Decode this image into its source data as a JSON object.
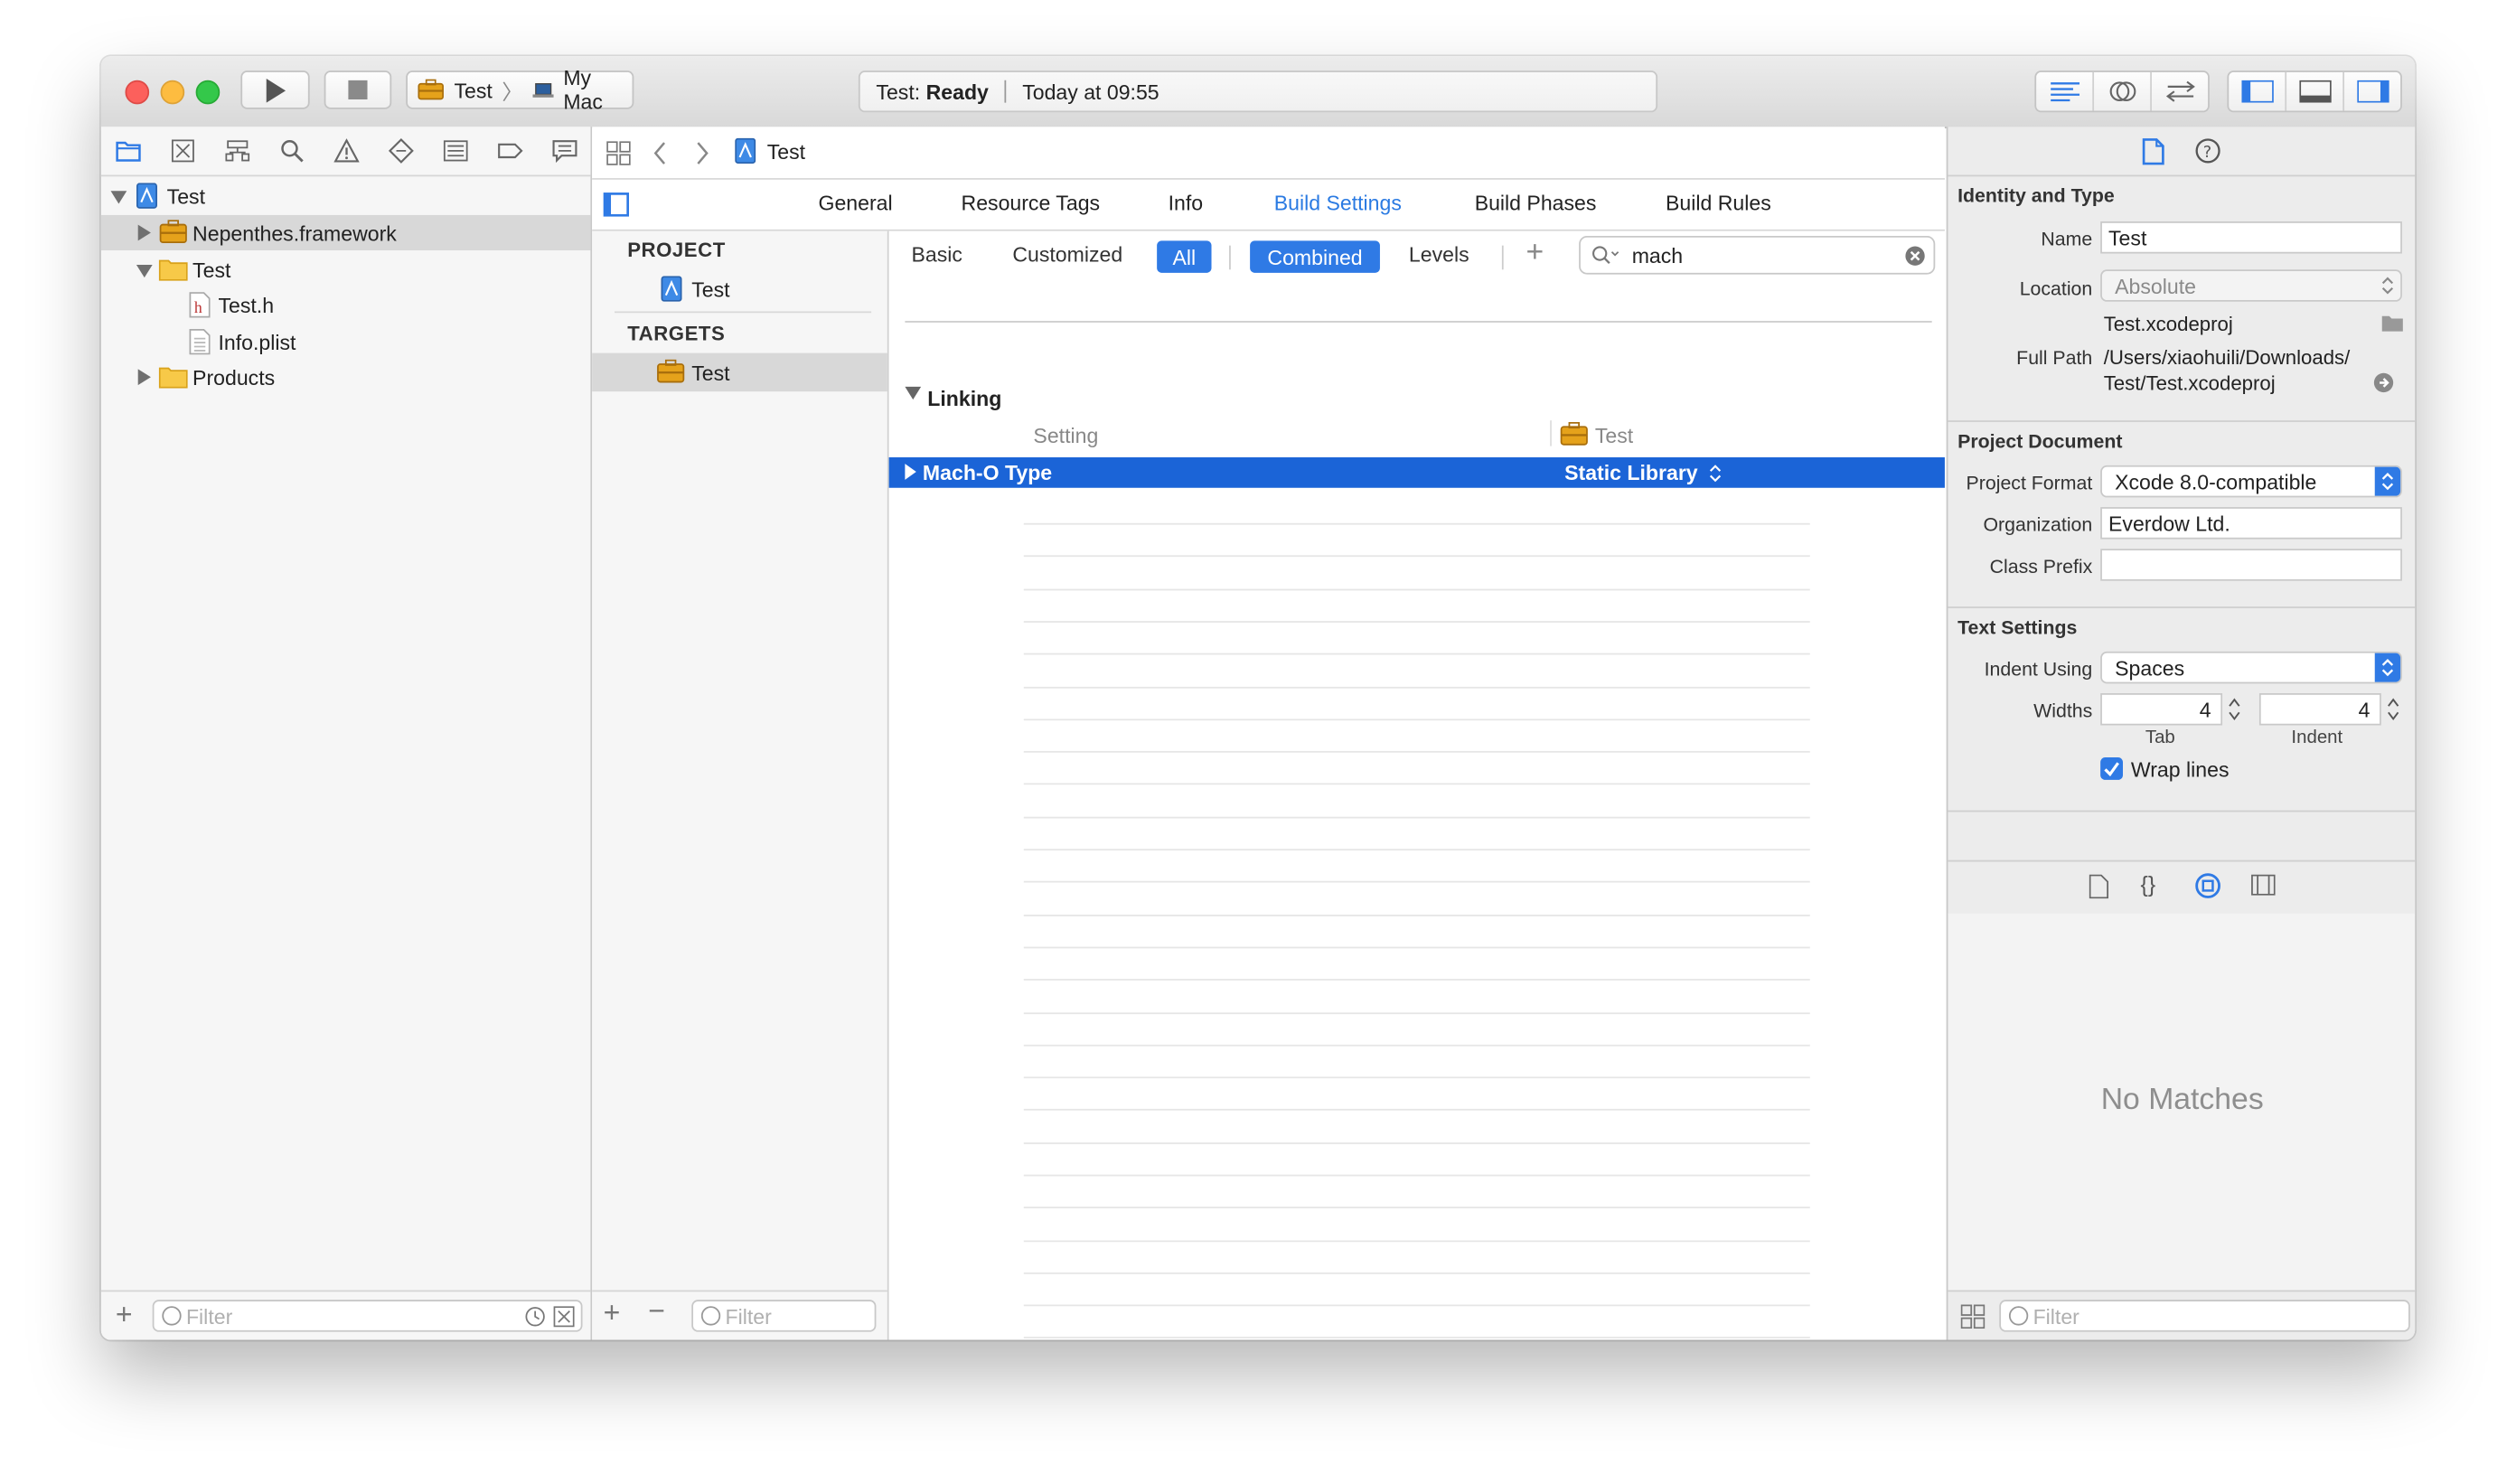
{
  "toolbar": {
    "scheme": "Test",
    "destination": "My Mac",
    "activity_prefix": "Test: ",
    "activity_status": "Ready",
    "activity_time": "Today at 09:55"
  },
  "navigator": {
    "tree": [
      {
        "label": "Test",
        "icon": "project-icon"
      },
      {
        "label": "Nepenthes.framework",
        "icon": "framework-icon"
      },
      {
        "label": "Test",
        "icon": "folder-icon"
      },
      {
        "label": "Test.h",
        "icon": "header-file-icon"
      },
      {
        "label": "Info.plist",
        "icon": "plist-file-icon"
      },
      {
        "label": "Products",
        "icon": "folder-icon"
      }
    ],
    "filter_placeholder": "Filter"
  },
  "jumpbar": {
    "crumb": "Test"
  },
  "tabs": [
    "General",
    "Resource Tags",
    "Info",
    "Build Settings",
    "Build Phases",
    "Build Rules"
  ],
  "active_tab": "Build Settings",
  "targets": {
    "project_header": "PROJECT",
    "project_item": "Test",
    "targets_header": "TARGETS",
    "target_item": "Test",
    "filter_placeholder": "Filter"
  },
  "settings": {
    "filters": [
      "Basic",
      "Customized",
      "All"
    ],
    "active_filter": "All",
    "views": [
      "Combined",
      "Levels"
    ],
    "active_view": "Combined",
    "search_value": "mach",
    "section": "Linking",
    "col_setting": "Setting",
    "col_target": "Test",
    "row_name": "Mach-O Type",
    "row_value": "Static Library"
  },
  "inspector": {
    "identity_title": "Identity and Type",
    "name_label": "Name",
    "name_value": "Test",
    "location_label": "Location",
    "location_value": "Absolute",
    "file_name": "Test.xcodeproj",
    "full_path_label": "Full Path",
    "full_path_line1": "/Users/xiaohuili/Downloads/",
    "full_path_line2": "Test/Test.xcodeproj",
    "project_doc_title": "Project Document",
    "format_label": "Project Format",
    "format_value": "Xcode 8.0-compatible",
    "org_label": "Organization",
    "org_value": "Everdow Ltd.",
    "prefix_label": "Class Prefix",
    "prefix_value": "",
    "text_settings_title": "Text Settings",
    "indent_label": "Indent Using",
    "indent_value": "Spaces",
    "widths_label": "Widths",
    "tab_width": "4",
    "indent_width": "4",
    "tab_caption": "Tab",
    "indent_caption": "Indent",
    "wrap_label": "Wrap lines",
    "wrap_checked": true,
    "no_matches": "No Matches",
    "filter_placeholder": "Filter"
  },
  "colors": {
    "accent": "#2f7ae5",
    "selection": "#1b64d7"
  }
}
